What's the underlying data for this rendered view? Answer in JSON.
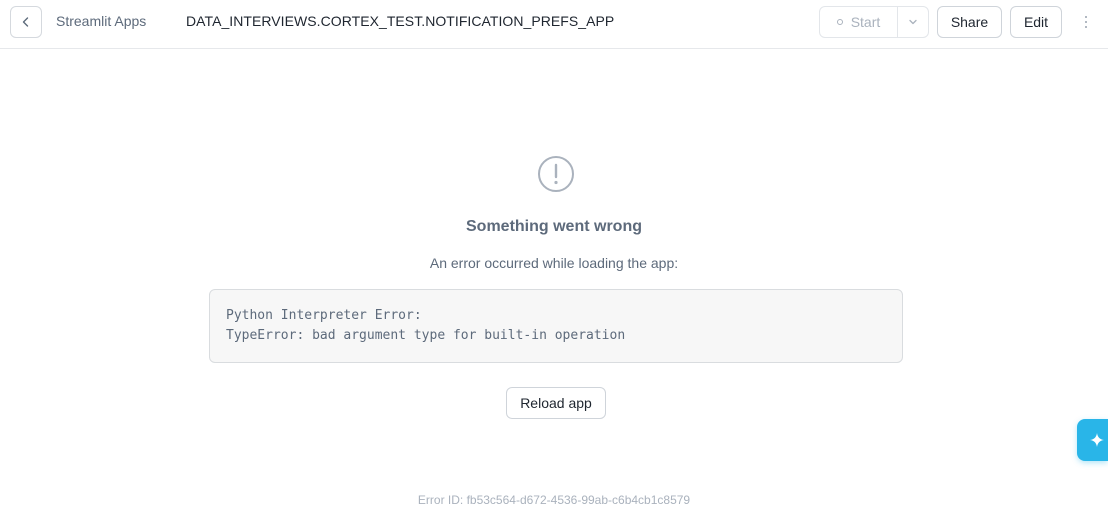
{
  "header": {
    "breadcrumb": "Streamlit Apps",
    "app_title": "DATA_INTERVIEWS.CORTEX_TEST.NOTIFICATION_PREFS_APP",
    "start_label": "Start",
    "share_label": "Share",
    "edit_label": "Edit"
  },
  "error": {
    "title": "Something went wrong",
    "subtitle": "An error occurred while loading the app:",
    "lines": [
      "Python Interpreter Error:",
      "TypeError: bad argument type for built-in operation"
    ],
    "reload_label": "Reload app",
    "error_id": "Error ID: fb53c564-d672-4536-99ab-c6b4cb1c8579"
  },
  "icons": {
    "back": "chevron-left-icon",
    "start_status": "circle-icon",
    "dropdown": "chevron-down-icon",
    "menu": "more-vertical-icon",
    "alert": "alert-circle-icon",
    "assistant": "sparkle-icon"
  },
  "colors": {
    "accent": "#29b5e8",
    "muted_text": "#5d6a7b",
    "disabled_text": "#aab2bd"
  }
}
